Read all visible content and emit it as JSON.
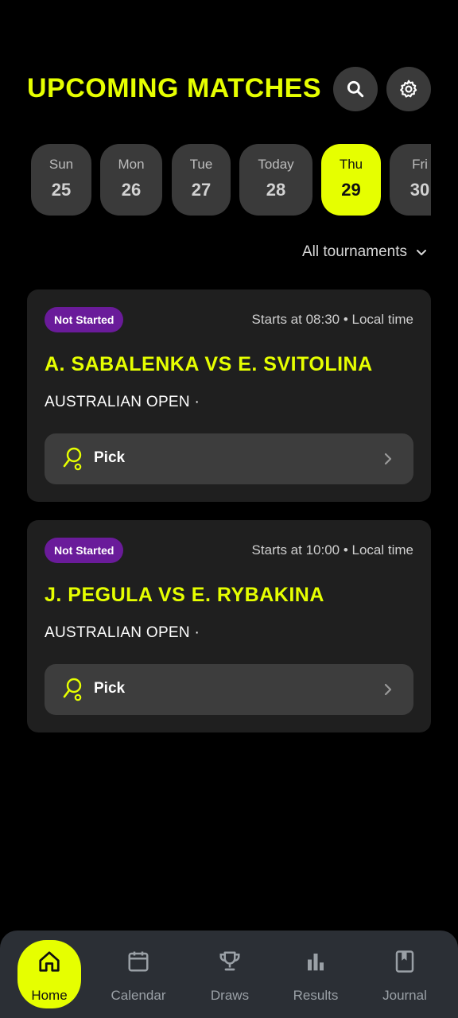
{
  "header": {
    "title": "UPCOMING MATCHES",
    "search_icon": "search-icon",
    "settings_icon": "gear-icon"
  },
  "dates": [
    {
      "dow": "Sun",
      "num": "25"
    },
    {
      "dow": "Mon",
      "num": "26"
    },
    {
      "dow": "Tue",
      "num": "27"
    },
    {
      "dow": "Today",
      "num": "28"
    },
    {
      "dow": "Thu",
      "num": "29",
      "selected": true
    },
    {
      "dow": "Fri",
      "num": "30"
    }
  ],
  "filter": {
    "label": "All tournaments",
    "icon": "chevron-down-icon"
  },
  "matches": [
    {
      "status": "Not Started",
      "start_time": "Starts at 08:30 • Local time",
      "title": "A. SABALENKA VS E. SVITOLINA",
      "tournament": "AUSTRALIAN OPEN ·",
      "pick_label": "Pick"
    },
    {
      "status": "Not Started",
      "start_time": "Starts at 10:00 • Local time",
      "title": "J. PEGULA VS E. RYBAKINA",
      "tournament": "AUSTRALIAN OPEN ·",
      "pick_label": "Pick"
    }
  ],
  "nav": [
    {
      "label": "Home",
      "icon": "home-icon",
      "active": true
    },
    {
      "label": "Calendar",
      "icon": "calendar-icon"
    },
    {
      "label": "Draws",
      "icon": "trophy-icon"
    },
    {
      "label": "Results",
      "icon": "bar-chart-icon"
    },
    {
      "label": "Journal",
      "icon": "bookmark-book-icon"
    }
  ],
  "colors": {
    "accent": "#E6FF00",
    "background": "#000000",
    "card": "#1f1f1f",
    "badge": "#6a1b9a",
    "nav_bar": "#2b2f35"
  }
}
